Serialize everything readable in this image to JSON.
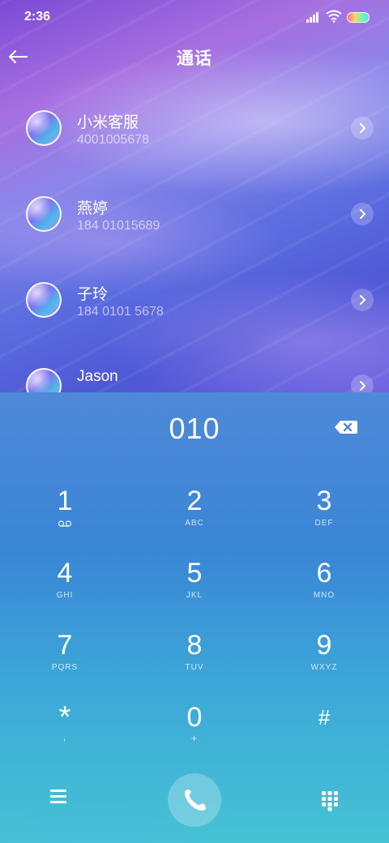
{
  "status_bar": {
    "time": "2:36"
  },
  "header": {
    "title": "通话"
  },
  "contacts": [
    {
      "name": "小米客服",
      "number": "4001005678"
    },
    {
      "name": "燕婷",
      "number": "184 01015689"
    },
    {
      "name": "子玲",
      "number": "184 0101 5678"
    },
    {
      "name": "Jason",
      "number": ""
    }
  ],
  "dialer": {
    "dialed_number": "010",
    "keys": [
      {
        "digit": "1",
        "sub": "",
        "sub_icon": "voicemail-icon"
      },
      {
        "digit": "2",
        "sub": "ABC"
      },
      {
        "digit": "3",
        "sub": "DEF"
      },
      {
        "digit": "4",
        "sub": "GHI"
      },
      {
        "digit": "5",
        "sub": "JKL"
      },
      {
        "digit": "6",
        "sub": "MNO"
      },
      {
        "digit": "7",
        "sub": "PQRS"
      },
      {
        "digit": "8",
        "sub": "TUV"
      },
      {
        "digit": "9",
        "sub": "WXYZ"
      },
      {
        "digit": "*",
        "sub": ","
      },
      {
        "digit": "0",
        "sub": "+"
      },
      {
        "digit": "#",
        "sub": ""
      }
    ]
  },
  "icons": {
    "back": "back-arrow-icon",
    "delete": "backspace-icon",
    "menu": "menu-icon",
    "call": "phone-icon",
    "keypad": "keypad-icon"
  }
}
